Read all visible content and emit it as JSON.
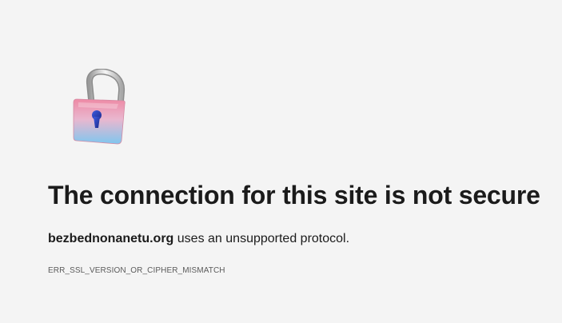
{
  "error": {
    "icon": "unlocked-padlock-icon",
    "title": "The connection for this site is not secure",
    "host": "bezbednonanetu.org",
    "message_suffix": "uses an unsupported protocol.",
    "code": "ERR_SSL_VERSION_OR_CIPHER_MISMATCH"
  },
  "colors": {
    "background": "#f4f4f4",
    "text": "#1b1b1b",
    "code_text": "#5a5a5a",
    "lock_pink": "#ea8ea6",
    "lock_blue": "#8ecbec",
    "keyhole": "#2a3fc0"
  }
}
